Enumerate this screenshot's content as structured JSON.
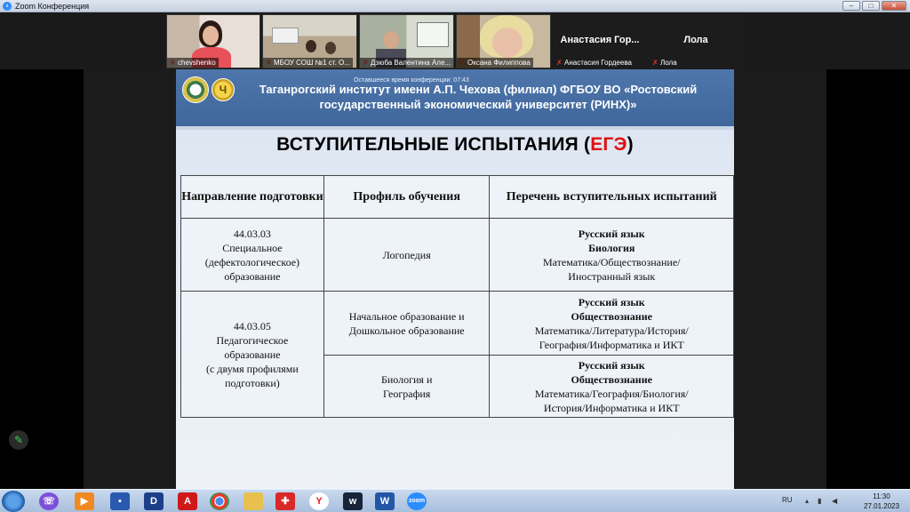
{
  "window": {
    "title": "Zoom Конференция",
    "app_icon": "zoom"
  },
  "gallery": {
    "tiles": [
      {
        "name": "chevshenko",
        "muted": true
      },
      {
        "name": "МБОУ СОШ №1 ст. О...",
        "muted": true
      },
      {
        "name": "Дзюба Валентина Але...",
        "muted": true
      },
      {
        "name": "Оксана Филиппова",
        "muted": true
      },
      {
        "name": "Анастасия Гордеева",
        "display": "Анастасия Гор...",
        "muted": true
      },
      {
        "name": "Лола",
        "display": "Лола",
        "muted": true
      }
    ]
  },
  "slide": {
    "remaining_time": "Оставшееся время конференции: 07:43",
    "institute_title_line1": "Таганрогский институт имени А.П. Чехова (филиал) ФГБОУ ВО «Ростовский",
    "institute_title_line2": "государственный экономический университет (РИНХ)»",
    "heading_main": "ВСТУПИТЕЛЬНЫЕ ИСПЫТАНИЯ (",
    "heading_red": "ЕГЭ",
    "heading_end": ")",
    "table": {
      "headers": [
        "Направление подготовки",
        "Профиль обучения",
        "Перечень вступительных испытаний"
      ],
      "rows": [
        {
          "direction_code": "44.03.03",
          "direction_name": [
            "Специальное",
            "(дефектологическое)",
            "образование"
          ],
          "profile": "Логопедия",
          "exams_bold": [
            "Русский язык",
            "Биология"
          ],
          "exams_normal": [
            "Математика/Обществознание/",
            "Иностранный язык"
          ]
        },
        {
          "direction_code": "44.03.05",
          "direction_name": [
            "Педагогическое",
            "образование",
            "(с двумя профилями",
            "подготовки)"
          ],
          "profile": "Начальное образование и Дошкольное образование",
          "profile_lines": [
            "Начальное образование и",
            "Дошкольное образование"
          ],
          "exams_bold": [
            "Русский язык",
            "Обществознание"
          ],
          "exams_normal": [
            "Математика/Литература/История/",
            "География/Информатика и ИКТ"
          ]
        },
        {
          "profile_lines": [
            "Биология и",
            "География"
          ],
          "exams_bold": [
            "Русский язык",
            "Обществознание"
          ],
          "exams_normal": [
            "Математика/География/Биология/",
            "История/Информатика и ИКТ"
          ]
        }
      ]
    }
  },
  "taskbar": {
    "language": "RU",
    "time": "11:30",
    "date": "27.01.2023",
    "icons": [
      "start",
      "viber-icon",
      "media-player-icon",
      "save-icon",
      "d-app-icon",
      "pdf-icon",
      "chrome-icon",
      "folder-icon",
      "puzzle-app-icon",
      "yandex-icon",
      "webinar-icon",
      "word-icon",
      "zoom-icon"
    ]
  }
}
